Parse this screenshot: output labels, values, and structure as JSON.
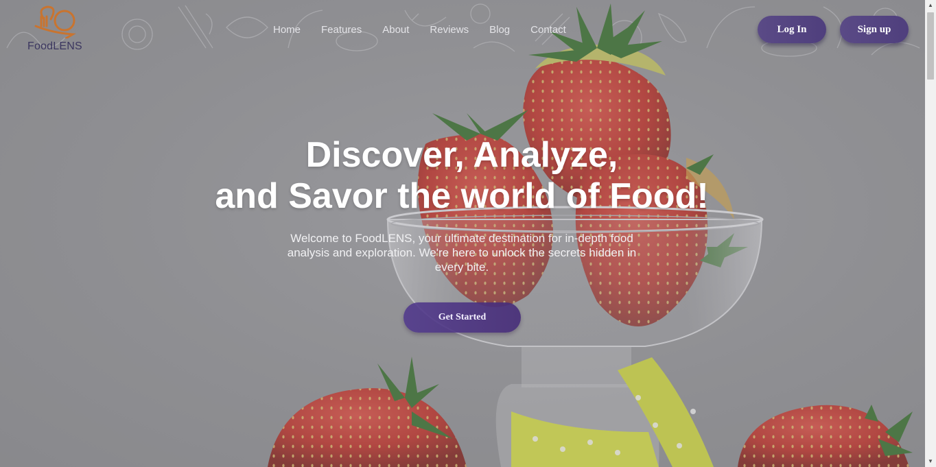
{
  "brand": {
    "name": "FoodLENS",
    "logo_color": "#c9742f",
    "text_color": "#3c3760"
  },
  "nav": {
    "links": [
      "Home",
      "Features",
      "About",
      "Reviews",
      "Blog",
      "Contact"
    ],
    "login_label": "Log In",
    "signup_label": "Sign up"
  },
  "hero": {
    "title_line1": "Discover, Analyze,",
    "title_line2": "and Savor the world of Food!",
    "subtitle": "Welcome to FoodLENS, your ultimate destination for in-depth food analysis and exploration. We're here to unlock the secrets hidden in every bite.",
    "cta_label": "Get Started"
  },
  "colors": {
    "accent": "#53437f",
    "overlay": "#8f8f93",
    "strawberry": "#c8261c",
    "leaf": "#2f6b22"
  },
  "icons": [
    "logo-icon",
    "chevron-up-icon",
    "chevron-down-icon"
  ]
}
